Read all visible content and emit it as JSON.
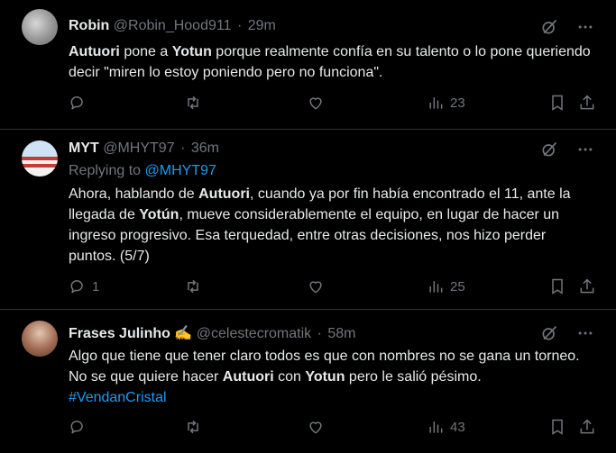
{
  "tweets": [
    {
      "name": "Robin",
      "handle": "@Robin_Hood911",
      "time": "29m",
      "text": [
        {
          "b": false,
          "t": ""
        },
        {
          "b": true,
          "t": "Autuori"
        },
        {
          "b": false,
          "t": " pone a "
        },
        {
          "b": true,
          "t": "Yotun"
        },
        {
          "b": false,
          "t": " porque realmente confía en su talento o lo pone queriendo decir \"miren lo estoy poniendo pero no funciona\"."
        }
      ],
      "replies": "",
      "retweets": "",
      "likes": "",
      "views": "23"
    },
    {
      "name": "MYT",
      "handle": "@MHYT97",
      "time": "36m",
      "replying_label": "Replying to",
      "replying_handle": "@MHYT97",
      "text": [
        {
          "b": false,
          "t": "Ahora, hablando de "
        },
        {
          "b": true,
          "t": "Autuori"
        },
        {
          "b": false,
          "t": ", cuando ya por fin había encontrado el 11, ante la llegada de "
        },
        {
          "b": true,
          "t": "Yotún"
        },
        {
          "b": false,
          "t": ", mueve considerablemente el equipo, en lugar de hacer un ingreso progresivo. Esa terquedad, entre otras decisiones, nos hizo perder puntos. (5/7)"
        }
      ],
      "replies": "1",
      "retweets": "",
      "likes": "",
      "views": "25"
    },
    {
      "name": "Frases Julinho ✍️",
      "handle": "@celestecromatik",
      "time": "58m",
      "text": [
        {
          "b": false,
          "t": "Algo que tiene que tener claro todos es que con nombres no se gana un torneo. No se que quiere hacer "
        },
        {
          "b": true,
          "t": "Autuori"
        },
        {
          "b": false,
          "t": " con "
        },
        {
          "b": true,
          "t": "Yotun"
        },
        {
          "b": false,
          "t": " pero le salió pésimo."
        }
      ],
      "hashtag": "#VendanCristal",
      "replies": "",
      "retweets": "",
      "likes": "",
      "views": "43"
    }
  ],
  "separator": "·",
  "colors": {
    "background": "#000000",
    "text": "#e7e9ea",
    "muted": "#71767b",
    "link": "#1d9bf0",
    "border": "#2f3336"
  },
  "icons": [
    "grok-icon",
    "more-icon",
    "reply-icon",
    "retweet-icon",
    "like-icon",
    "views-icon",
    "bookmark-icon",
    "share-icon"
  ]
}
